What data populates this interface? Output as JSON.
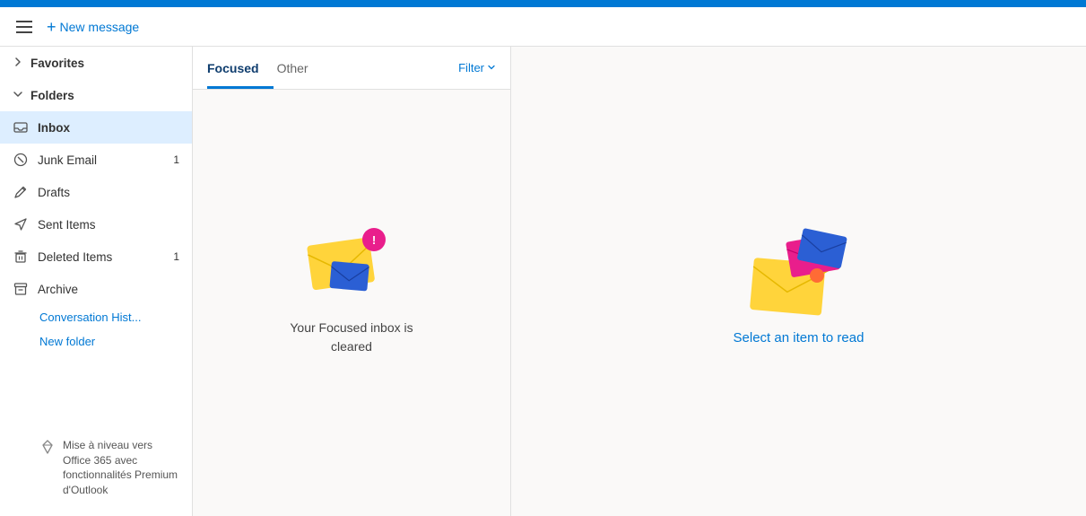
{
  "topbar": {
    "color": "#0078d4"
  },
  "header": {
    "new_message_label": "New message",
    "plus_symbol": "+"
  },
  "sidebar": {
    "favorites_label": "Favorites",
    "folders_label": "Folders",
    "items": [
      {
        "id": "inbox",
        "label": "Inbox",
        "badge": "",
        "active": true
      },
      {
        "id": "junk",
        "label": "Junk Email",
        "badge": "1",
        "active": false
      },
      {
        "id": "drafts",
        "label": "Drafts",
        "badge": "",
        "active": false
      },
      {
        "id": "sent",
        "label": "Sent Items",
        "badge": "",
        "active": false
      },
      {
        "id": "deleted",
        "label": "Deleted Items",
        "badge": "1",
        "active": false
      },
      {
        "id": "archive",
        "label": "Archive",
        "badge": "",
        "active": false
      }
    ],
    "conversation_hist_label": "Conversation Hist...",
    "new_folder_label": "New folder",
    "upgrade_text": "Mise à niveau vers Office 365 avec fonctionnalités Premium d'Outlook"
  },
  "email_panel": {
    "tabs": [
      {
        "id": "focused",
        "label": "Focused",
        "active": true
      },
      {
        "id": "other",
        "label": "Other",
        "active": false
      }
    ],
    "filter_label": "Filter",
    "empty_text": "Your Focused inbox is\ncleared"
  },
  "reading_pane": {
    "select_text": "Select an item to read"
  }
}
